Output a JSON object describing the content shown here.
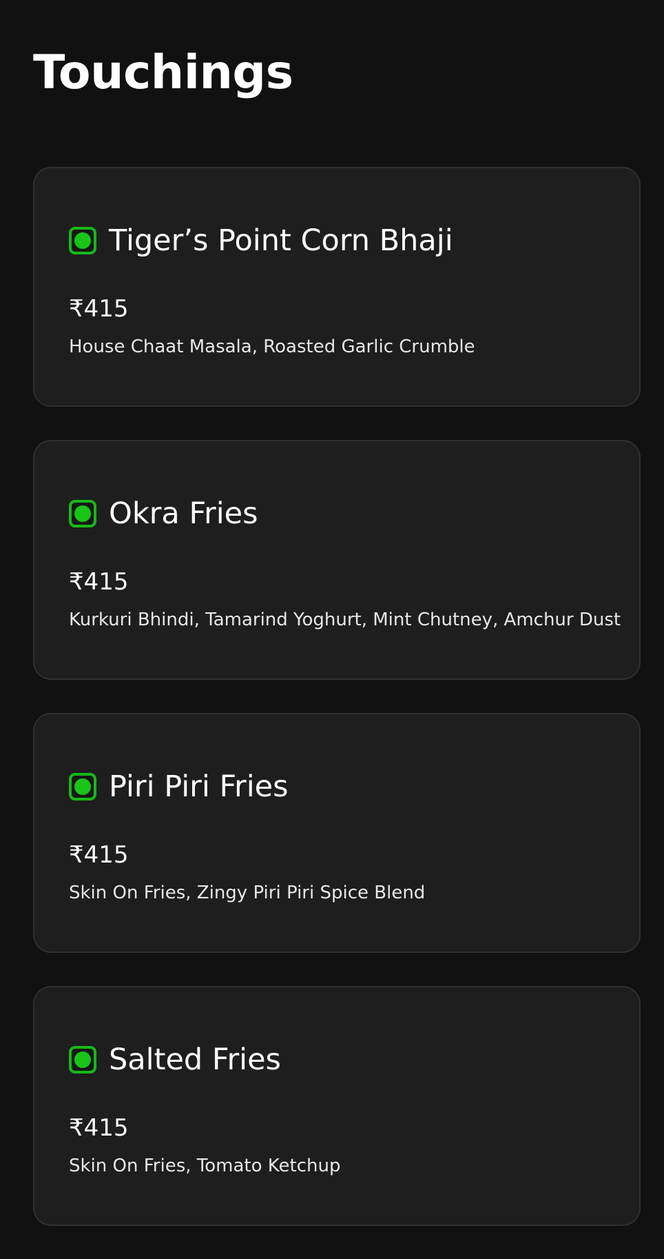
{
  "section": {
    "title": "Touchings"
  },
  "items": [
    {
      "name": "Tiger’s Point Corn Bhaji",
      "price": "₹415",
      "description": "House Chaat Masala, Roasted Garlic Crumble",
      "icon": "veg-icon"
    },
    {
      "name": "Okra Fries",
      "price": "₹415",
      "description": "Kurkuri Bhindi, Tamarind Yoghurt, Mint Chutney, Amchur Dust",
      "icon": "veg-icon"
    },
    {
      "name": "Piri Piri Fries",
      "price": "₹415",
      "description": "Skin On Fries, Zingy Piri Piri Spice Blend",
      "icon": "veg-icon"
    },
    {
      "name": "Salted Fries",
      "price": "₹415",
      "description": "Skin On Fries, Tomato Ketchup",
      "icon": "veg-icon"
    }
  ],
  "colors": {
    "background": "#111111",
    "card": "#1e1e1f",
    "card_border": "#303030",
    "veg_green": "#18b818"
  }
}
